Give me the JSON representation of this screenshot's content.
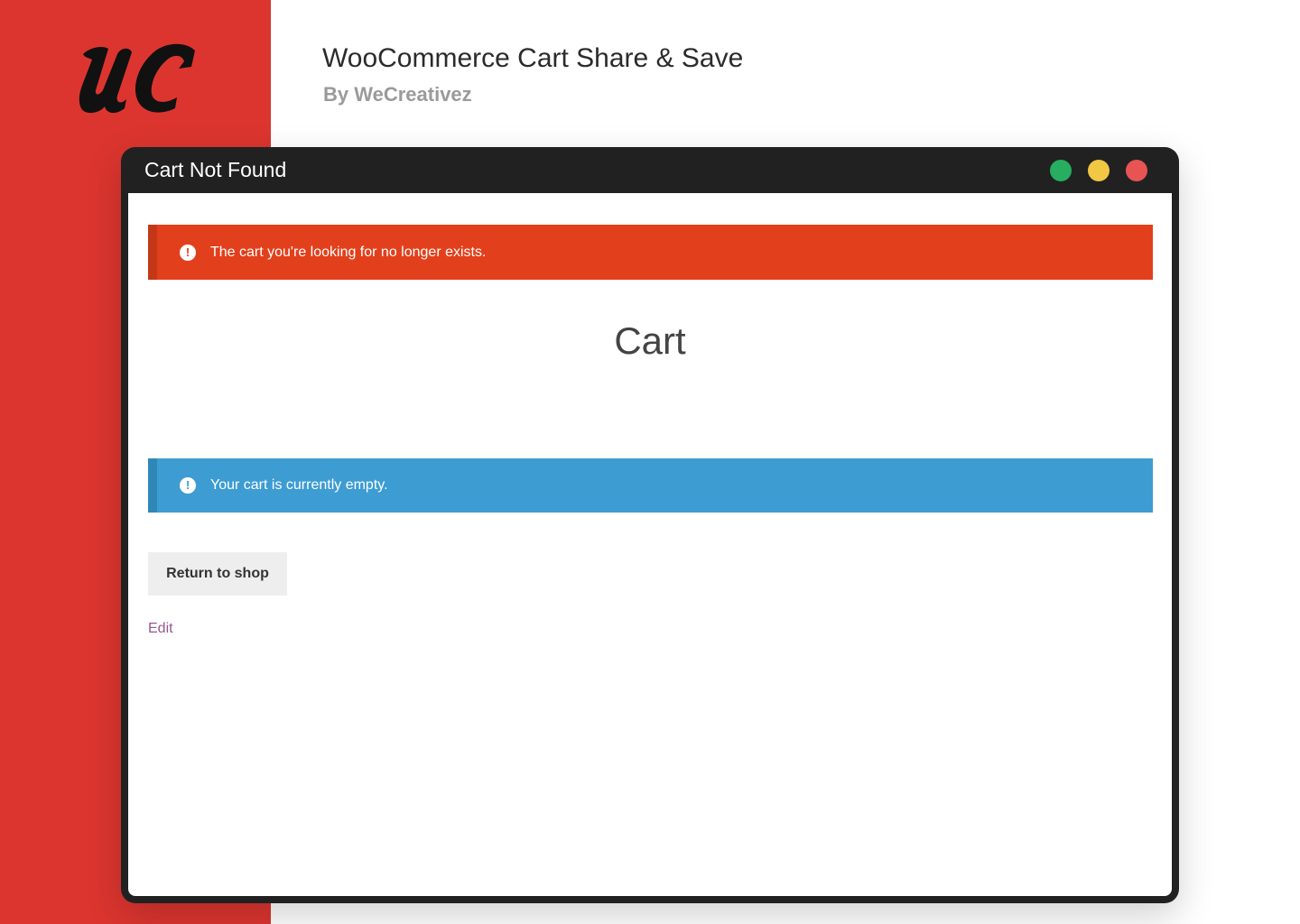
{
  "brand": {
    "logo_text": "uc",
    "panel_color": "#dc352f"
  },
  "header": {
    "title": "WooCommerce Cart Share & Save",
    "subtitle": "By WeCreativez"
  },
  "window": {
    "title": "Cart Not Found",
    "controls": [
      {
        "name": "green",
        "color": "#27ae60"
      },
      {
        "name": "yellow",
        "color": "#f2c744"
      },
      {
        "name": "red",
        "color": "#e85454"
      }
    ]
  },
  "page": {
    "error_notice": {
      "icon": "exclamation-circle-icon",
      "text": "The cart you're looking for no longer exists.",
      "color": "#e2401c"
    },
    "heading": "Cart",
    "info_notice": {
      "icon": "exclamation-circle-icon",
      "text": "Your cart is currently empty.",
      "color": "#3d9cd2"
    },
    "return_button_label": "Return to shop",
    "edit_link_label": "Edit"
  }
}
